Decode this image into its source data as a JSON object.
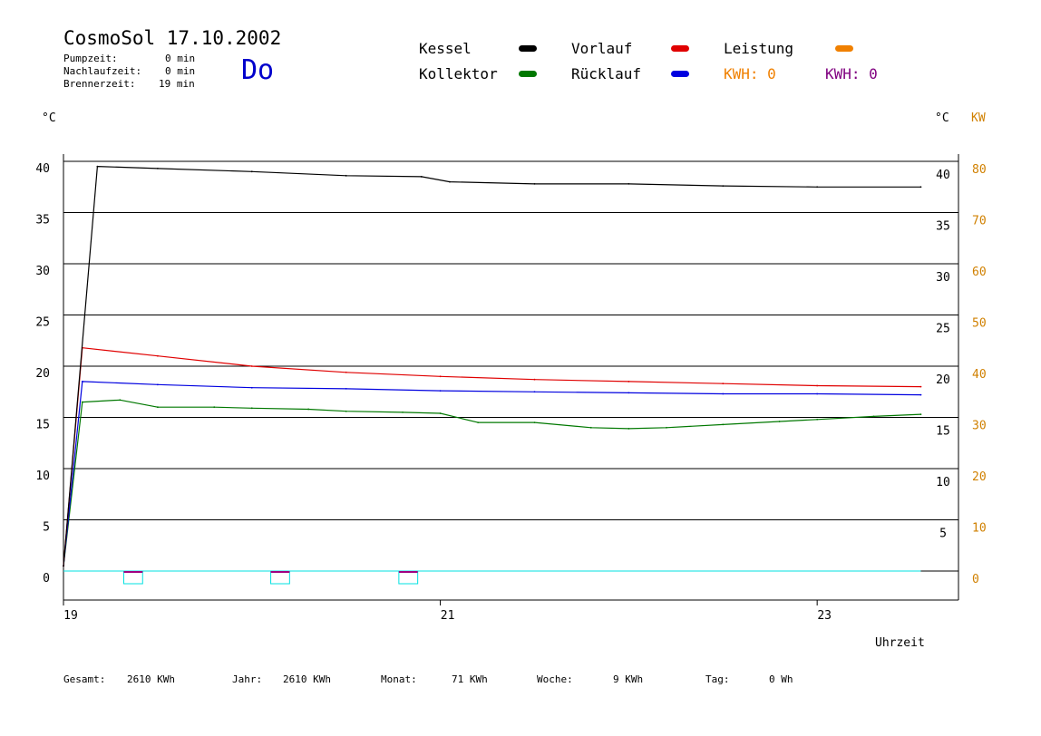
{
  "header": {
    "title": "CosmoSol 17.10.2002",
    "day": "Do",
    "stats": [
      {
        "label": "Pumpzeit:",
        "value": "0 min"
      },
      {
        "label": "Nachlaufzeit:",
        "value": "0 min"
      },
      {
        "label": "Brennerzeit:",
        "value": "19 min"
      }
    ]
  },
  "legend": {
    "kessel": "Kessel",
    "kollektor": "Kollektor",
    "vorlauf": "Vorlauf",
    "ruecklauf": "Rücklauf",
    "leistung": "Leistung",
    "kwh_orange": "KWH: 0",
    "kwh_purple": "KWH: 0"
  },
  "colors": {
    "kessel": "#000000",
    "kollektor": "#007800",
    "vorlauf": "#e00000",
    "ruecklauf": "#0000e0",
    "leistung": "#f08000",
    "kwh_purple": "#800080",
    "pump": "#00e0e0",
    "brenner": "#a00080",
    "kw_axis": "#d08000"
  },
  "axes": {
    "left_unit": "°C",
    "right_unit": "°C",
    "kw_unit": "KW",
    "xlabel": "Uhrzeit"
  },
  "footer": [
    {
      "label": "Gesamt:",
      "value": "2610 KWh"
    },
    {
      "label": "Jahr:",
      "value": "2610 KWh"
    },
    {
      "label": "Monat:",
      "value": "71 KWh"
    },
    {
      "label": "Woche:",
      "value": "9 KWh"
    },
    {
      "label": "Tag:",
      "value": "0 Wh"
    }
  ],
  "chart_data": {
    "type": "line",
    "title": "CosmoSol 17.10.2002",
    "xlabel": "Uhrzeit",
    "ylabel": "°C",
    "xlim": [
      19,
      23.75
    ],
    "ylim": [
      0,
      40
    ],
    "y2lim": [
      0,
      80
    ],
    "x_ticks": [
      19,
      21,
      23
    ],
    "y_ticks": [
      0,
      5,
      10,
      15,
      20,
      25,
      30,
      35,
      40
    ],
    "y_ticks_right": [
      5,
      10,
      15,
      20,
      25,
      30,
      35,
      40
    ],
    "y2_ticks": [
      0,
      10,
      20,
      30,
      40,
      50,
      60,
      70,
      80
    ],
    "grid": true,
    "series": [
      {
        "name": "Kessel",
        "color": "#000000",
        "x": [
          19.0,
          19.18,
          19.5,
          20.0,
          20.5,
          20.9,
          21.05,
          21.5,
          22.0,
          22.5,
          23.0,
          23.55
        ],
        "y": [
          0.5,
          39.5,
          39.3,
          39.0,
          38.6,
          38.5,
          38.0,
          37.8,
          37.8,
          37.6,
          37.5,
          37.5
        ]
      },
      {
        "name": "Vorlauf",
        "color": "#e00000",
        "x": [
          19.0,
          19.1,
          19.5,
          20.0,
          20.5,
          21.0,
          21.5,
          22.0,
          22.5,
          23.0,
          23.55
        ],
        "y": [
          0.5,
          21.8,
          21.0,
          20.0,
          19.4,
          19.0,
          18.7,
          18.5,
          18.3,
          18.1,
          18.0
        ]
      },
      {
        "name": "Rücklauf",
        "color": "#0000e0",
        "x": [
          19.0,
          19.1,
          19.5,
          20.0,
          20.5,
          21.0,
          21.5,
          22.0,
          22.5,
          23.0,
          23.55
        ],
        "y": [
          0.5,
          18.5,
          18.2,
          17.9,
          17.8,
          17.6,
          17.5,
          17.4,
          17.3,
          17.3,
          17.2
        ]
      },
      {
        "name": "Kollektor",
        "color": "#007800",
        "x": [
          19.0,
          19.1,
          19.3,
          19.5,
          19.8,
          20.0,
          20.3,
          20.5,
          20.8,
          21.0,
          21.2,
          21.5,
          21.8,
          22.0,
          22.2,
          22.5,
          22.8,
          23.0,
          23.3,
          23.55
        ],
        "y": [
          0.5,
          16.5,
          16.7,
          16.0,
          16.0,
          15.9,
          15.8,
          15.6,
          15.5,
          15.4,
          14.5,
          14.5,
          14.0,
          13.9,
          14.0,
          14.3,
          14.6,
          14.8,
          15.1,
          15.3
        ]
      }
    ],
    "pump_line": {
      "name": "Pumpe",
      "color": "#00e0e0",
      "y": 0
    },
    "brenner_pulses": [
      {
        "start": 19.32,
        "end": 19.42
      },
      {
        "start": 20.1,
        "end": 20.2
      },
      {
        "start": 20.78,
        "end": 20.88
      }
    ]
  }
}
